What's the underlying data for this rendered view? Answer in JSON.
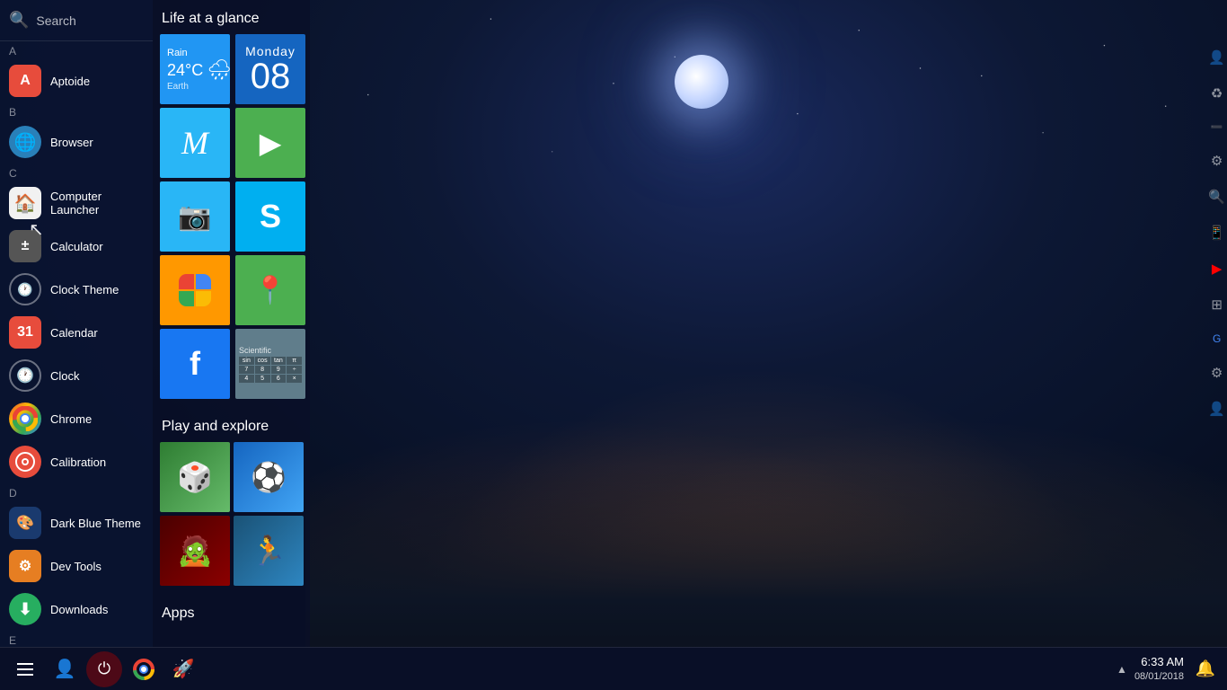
{
  "app": {
    "title": "Computer Launcher",
    "wallpaper_desc": "Night city panorama with moon and stars"
  },
  "sidebar": {
    "search_placeholder": "Search",
    "search_label": "Search",
    "sections": [
      {
        "letter": "A",
        "items": [
          {
            "id": "aptoide",
            "label": "Aptoide",
            "icon": "aptoide-icon",
            "icon_char": "A"
          },
          {
            "id": "browser",
            "label": "Browser",
            "icon": "browser-icon",
            "icon_char": "🌐"
          }
        ]
      },
      {
        "letter": "B",
        "items": []
      },
      {
        "letter": "C",
        "items": [
          {
            "id": "computer-launcher",
            "label": "Computer Launcher",
            "icon": "computer-launcher-icon",
            "icon_char": "🏠"
          },
          {
            "id": "calculator",
            "label": "Calculator",
            "icon": "calculator-icon",
            "icon_char": "🖩"
          },
          {
            "id": "clock-theme",
            "label": "Clock Theme",
            "icon": "clock-theme-icon",
            "icon_char": "🕐"
          },
          {
            "id": "calendar",
            "label": "Calendar",
            "icon": "calendar-icon",
            "icon_char": "31"
          },
          {
            "id": "clock",
            "label": "Clock",
            "icon": "clock-icon",
            "icon_char": "🕐"
          },
          {
            "id": "chrome",
            "label": "Chrome",
            "icon": "chrome-icon",
            "icon_char": "◉"
          },
          {
            "id": "calibration",
            "label": "Calibration",
            "icon": "calibration-icon",
            "icon_char": "⊙"
          }
        ]
      },
      {
        "letter": "D",
        "items": [
          {
            "id": "dark-blue-theme",
            "label": "Dark Blue Theme",
            "icon": "dark-blue-theme-icon",
            "icon_char": "🎨"
          },
          {
            "id": "dev-tools",
            "label": "Dev Tools",
            "icon": "dev-tools-icon",
            "icon_char": "⚙"
          },
          {
            "id": "downloads",
            "label": "Downloads",
            "icon": "downloads-icon",
            "icon_char": "⬇"
          }
        ]
      },
      {
        "letter": "E",
        "items": []
      }
    ]
  },
  "life_at_a_glance": {
    "title": "Life at a glance",
    "tiles": [
      {
        "id": "weather",
        "type": "weather",
        "label": "Rain",
        "temp": "24°C",
        "earth": "Earth"
      },
      {
        "id": "date",
        "type": "date",
        "day_name": "Monday",
        "day_num": "08"
      },
      {
        "id": "gmail",
        "type": "app",
        "label": "Gmail",
        "color": "#29b6f6"
      },
      {
        "id": "play-store",
        "type": "app",
        "label": "Play Store",
        "color": "#4caf50"
      },
      {
        "id": "camera",
        "type": "app",
        "label": "Camera",
        "color": "#29b6f6"
      },
      {
        "id": "skype",
        "type": "app",
        "label": "Skype",
        "color": "#00aff0"
      },
      {
        "id": "photos",
        "type": "app",
        "label": "Photos",
        "color": "#ff9800"
      },
      {
        "id": "maps",
        "type": "app",
        "label": "Maps",
        "color": "#4caf50"
      },
      {
        "id": "facebook",
        "type": "app",
        "label": "Facebook",
        "color": "#1877f2"
      },
      {
        "id": "scientific-calc",
        "type": "app",
        "label": "Scientific Calculator",
        "color": "#607d8b"
      }
    ]
  },
  "play_and_explore": {
    "title": "Play and explore",
    "games": [
      {
        "id": "game1",
        "label": "Board Game",
        "icon": "🎲"
      },
      {
        "id": "game2",
        "label": "Soccer Game",
        "icon": "⚽"
      },
      {
        "id": "game3",
        "label": "Zombie Game",
        "icon": "🧟"
      },
      {
        "id": "game4",
        "label": "Sports Game",
        "icon": "🏃"
      }
    ]
  },
  "apps_section": {
    "title": "Apps"
  },
  "taskbar": {
    "menu_icon": "menu-icon",
    "contacts_icon": "contacts-icon",
    "power_icon": "power-icon",
    "chrome_icon": "chrome-taskbar-icon",
    "launcher_icon": "launcher-taskbar-icon",
    "time": "6:33 AM",
    "date": "08/01/2018",
    "notification_icon": "notification-icon",
    "chevron_icon": "chevron-up-icon"
  },
  "icons": {
    "menu": "☰",
    "search": "🔍",
    "user": "👤",
    "home": "🏠",
    "recycle": "♻",
    "settings": "⚙",
    "whatsapp": "📱",
    "youtube": "▶",
    "power": "⏻",
    "bell": "🔔",
    "chevron_up": "▲"
  }
}
